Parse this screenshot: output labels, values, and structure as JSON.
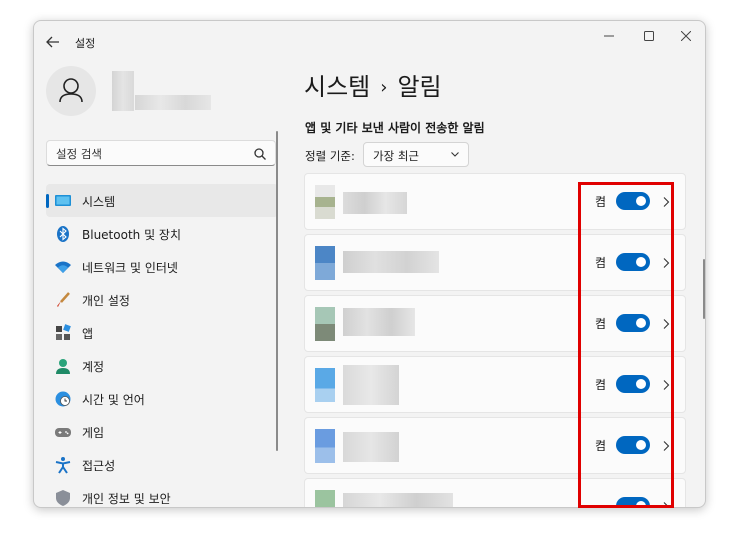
{
  "window": {
    "title": "설정"
  },
  "profile": {},
  "search": {
    "placeholder": "설정 검색"
  },
  "sidebar": {
    "items": [
      {
        "label": "시스템",
        "icon": "monitor-icon",
        "active": true
      },
      {
        "label": "Bluetooth 및 장치",
        "icon": "bluetooth-icon"
      },
      {
        "label": "네트워크 및 인터넷",
        "icon": "wifi-icon"
      },
      {
        "label": "개인 설정",
        "icon": "brush-icon"
      },
      {
        "label": "앱",
        "icon": "apps-icon"
      },
      {
        "label": "계정",
        "icon": "person-icon"
      },
      {
        "label": "시간 및 언어",
        "icon": "globe-clock-icon"
      },
      {
        "label": "게임",
        "icon": "gamepad-icon"
      },
      {
        "label": "접근성",
        "icon": "accessibility-icon"
      },
      {
        "label": "개인 정보 및 보안",
        "icon": "shield-icon"
      }
    ]
  },
  "breadcrumb": {
    "parent": "시스템",
    "separator": "›",
    "current": "알림"
  },
  "section": {
    "title": "앱 및 기타 보낸 사람이 전송한 알림"
  },
  "sort": {
    "label": "정렬 기준:",
    "value": "가장 최근"
  },
  "notifications": [
    {
      "state": "켬",
      "on": true
    },
    {
      "state": "켬",
      "on": true
    },
    {
      "state": "켬",
      "on": true
    },
    {
      "state": "켬",
      "on": true
    },
    {
      "state": "켬",
      "on": true
    },
    {
      "state": "",
      "on": true
    }
  ],
  "colors": {
    "accent": "#0067c0",
    "highlight": "#e00000",
    "window_bg": "#f3f3f3"
  }
}
